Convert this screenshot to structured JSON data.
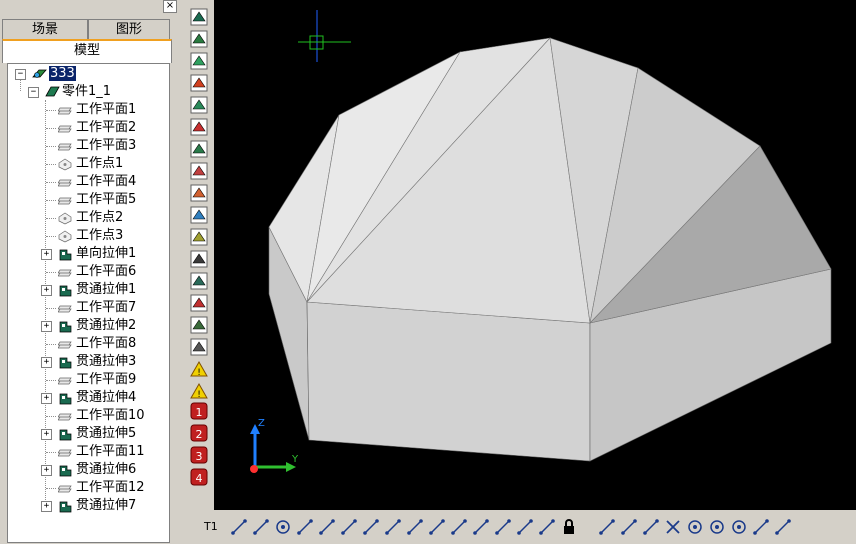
{
  "panel": {
    "tabs": [
      "场景",
      "图形"
    ],
    "active_tab": "模型",
    "close_glyph": "×"
  },
  "tree": {
    "root": "333",
    "part": "零件1_1",
    "items": [
      {
        "label": "工作平面1",
        "icon": "work-plane-icon",
        "expandable": false
      },
      {
        "label": "工作平面2",
        "icon": "work-plane-icon",
        "expandable": false
      },
      {
        "label": "工作平面3",
        "icon": "work-plane-icon",
        "expandable": false
      },
      {
        "label": "工作点1",
        "icon": "work-point-icon",
        "expandable": false
      },
      {
        "label": "工作平面4",
        "icon": "work-plane-icon",
        "expandable": false
      },
      {
        "label": "工作平面5",
        "icon": "work-plane-icon",
        "expandable": false
      },
      {
        "label": "工作点2",
        "icon": "work-point-icon",
        "expandable": false
      },
      {
        "label": "工作点3",
        "icon": "work-point-icon",
        "expandable": false
      },
      {
        "label": "单向拉伸1",
        "icon": "extrude-icon",
        "expandable": true
      },
      {
        "label": "工作平面6",
        "icon": "work-plane-icon",
        "expandable": false
      },
      {
        "label": "贯通拉伸1",
        "icon": "extrude-icon",
        "expandable": true
      },
      {
        "label": "工作平面7",
        "icon": "work-plane-icon",
        "expandable": false
      },
      {
        "label": "贯通拉伸2",
        "icon": "extrude-icon",
        "expandable": true
      },
      {
        "label": "工作平面8",
        "icon": "work-plane-icon",
        "expandable": false
      },
      {
        "label": "贯通拉伸3",
        "icon": "extrude-icon",
        "expandable": true
      },
      {
        "label": "工作平面9",
        "icon": "work-plane-icon",
        "expandable": false
      },
      {
        "label": "贯通拉伸4",
        "icon": "extrude-icon",
        "expandable": true
      },
      {
        "label": "工作平面10",
        "icon": "work-plane-icon",
        "expandable": false
      },
      {
        "label": "贯通拉伸5",
        "icon": "extrude-icon",
        "expandable": true
      },
      {
        "label": "工作平面11",
        "icon": "work-plane-icon",
        "expandable": false
      },
      {
        "label": "贯通拉伸6",
        "icon": "extrude-icon",
        "expandable": true
      },
      {
        "label": "工作平面12",
        "icon": "work-plane-icon",
        "expandable": false
      },
      {
        "label": "贯通拉伸7",
        "icon": "extrude-icon",
        "expandable": true
      }
    ]
  },
  "vtoolbar": {
    "icons": [
      "sketch-icon",
      "extrude-tool-icon",
      "revolve-icon",
      "sweep-icon",
      "loft-icon",
      "shell-icon",
      "fillet-icon",
      "chamfer-icon",
      "pattern-icon",
      "mirror-icon",
      "draft-icon",
      "split-icon",
      "rib-icon",
      "hole-icon",
      "thread-icon",
      "face-icon",
      "warning-triangle-icon",
      "warning-triangle-icon-2"
    ],
    "number_icons": [
      "1",
      "2",
      "3",
      "4"
    ]
  },
  "htoolbar": {
    "first_label": "T1",
    "icons": [
      "text-tool-icon",
      "arc-icon",
      "circle-icon",
      "angle-dimension-icon",
      "linear-dimension-icon",
      "perpendicular-icon",
      "horizontal-icon",
      "vertical-icon",
      "coincident-icon",
      "tangent-icon",
      "offset-icon",
      "parallel-icon",
      "symmetric-icon",
      "equal-icon",
      "fix-icon",
      "lock-icon",
      "trim-icon",
      "line-icon",
      "polyline-icon",
      "cross-icon",
      "center-circle-icon",
      "target-icon",
      "rotate-icon",
      "edge-icon",
      "arrow-icon"
    ]
  },
  "viewport": {
    "background": "#000000",
    "axis_labels": {
      "z": "Z",
      "y": "Y"
    },
    "colors": {
      "x": "#ff3030",
      "y": "#30c030",
      "z": "#2080ff"
    }
  }
}
